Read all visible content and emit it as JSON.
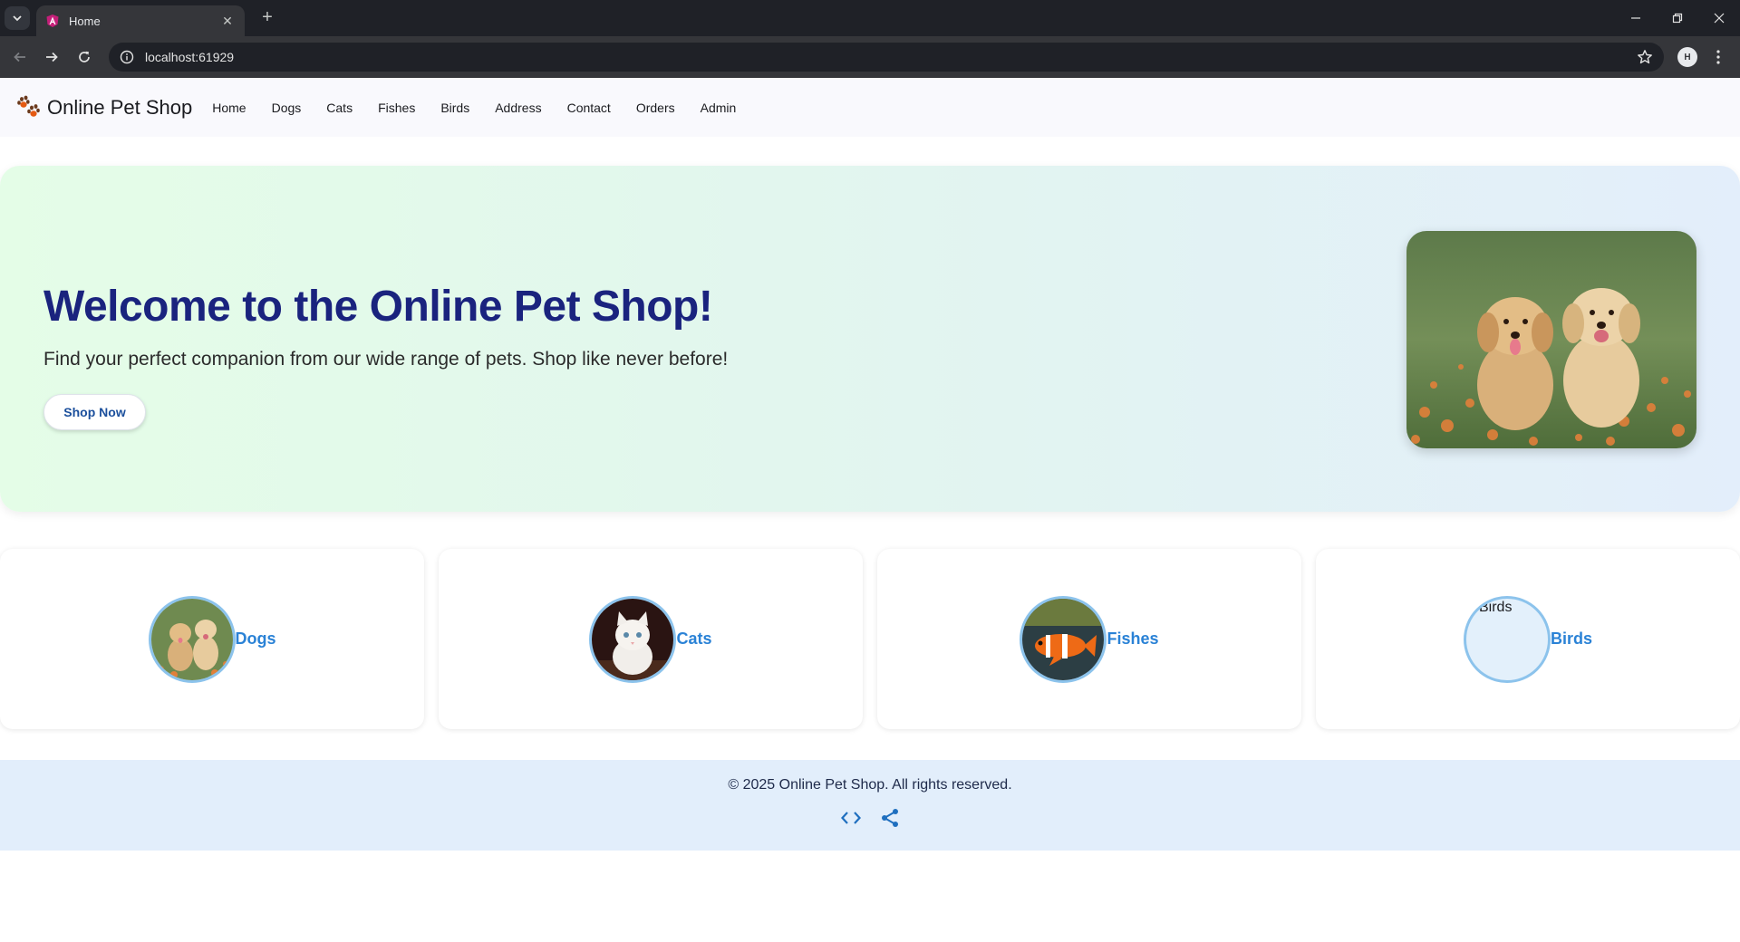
{
  "browser": {
    "tab_title": "Home",
    "url": "localhost:61929",
    "profile_initial": "H"
  },
  "appbar": {
    "title": "Online Pet Shop",
    "nav": [
      "Home",
      "Dogs",
      "Cats",
      "Fishes",
      "Birds",
      "Address",
      "Contact",
      "Orders",
      "Admin"
    ]
  },
  "hero": {
    "title": "Welcome to the Online Pet Shop!",
    "subtitle": "Find your perfect companion from our wide range of pets. Shop like never before!",
    "button": "Shop Now"
  },
  "categories": [
    {
      "label": "Dogs",
      "image": "puppies-photo"
    },
    {
      "label": "Cats",
      "image": "kitten-photo"
    },
    {
      "label": "Fishes",
      "image": "clownfish-photo"
    },
    {
      "label": "Birds",
      "image": "broken-image",
      "alt": "Birds"
    }
  ],
  "footer": {
    "copyright": "© 2025 Online Pet Shop. All rights reserved.",
    "icons": [
      "code-icon",
      "share-icon"
    ]
  },
  "colors": {
    "accent": "#1a237e",
    "link": "#2a82d6",
    "footer_bg": "#e2eefb"
  }
}
